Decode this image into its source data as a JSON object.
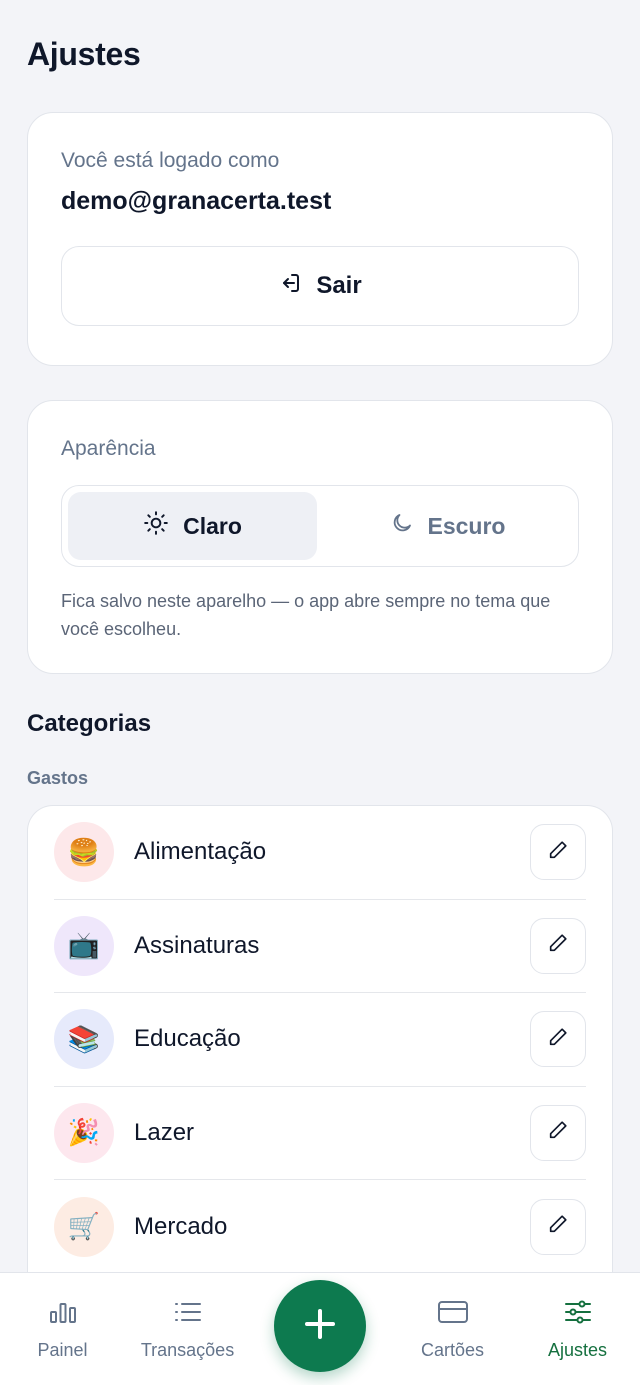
{
  "page": {
    "title": "Ajustes"
  },
  "account": {
    "label": "Você está logado como",
    "email": "demo@granacerta.test",
    "logout_label": "Sair"
  },
  "appearance": {
    "title": "Aparência",
    "options": [
      {
        "label": "Claro",
        "icon": "sun-icon",
        "selected": true
      },
      {
        "label": "Escuro",
        "icon": "moon-icon",
        "selected": false
      }
    ],
    "hint": "Fica salvo neste aparelho — o app abre sempre no tema que você escolheu."
  },
  "categories": {
    "title": "Categorias",
    "expenses_title": "Gastos",
    "items": [
      {
        "label": "Alimentação",
        "emoji": "🍔",
        "bg": "#fde8ea"
      },
      {
        "label": "Assinaturas",
        "emoji": "📺",
        "bg": "#efe7fb"
      },
      {
        "label": "Educação",
        "emoji": "📚",
        "bg": "#e6eafb"
      },
      {
        "label": "Lazer",
        "emoji": "🎉",
        "bg": "#fde7ee"
      },
      {
        "label": "Mercado",
        "emoji": "🛒",
        "bg": "#fdece3"
      }
    ]
  },
  "nav": {
    "items": [
      {
        "label": "Painel",
        "icon": "bar-chart-icon"
      },
      {
        "label": "Transações",
        "icon": "list-icon"
      },
      {
        "label": "Cartões",
        "icon": "credit-card-icon"
      },
      {
        "label": "Ajustes",
        "icon": "sliders-icon",
        "active": true
      }
    ],
    "fab_icon": "plus-icon"
  },
  "colors": {
    "accent": "#0d7a4f",
    "nav_active": "#15703f",
    "background": "#f3f4f8"
  }
}
